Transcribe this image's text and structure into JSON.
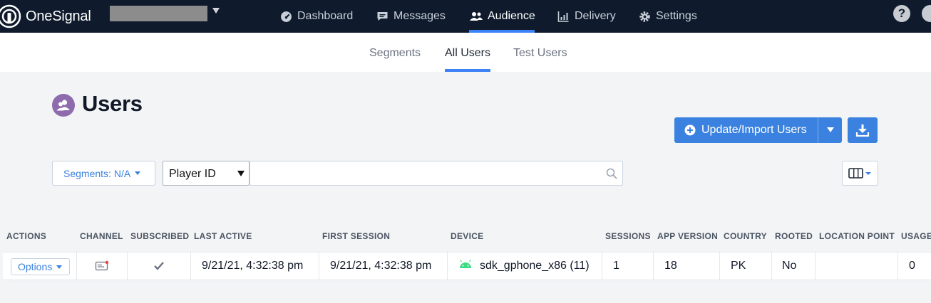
{
  "brand": {
    "name": "OneSignal",
    "accent": "#3b82e0",
    "nav_bg": "#0f1b2d"
  },
  "app_selector": {
    "value": ""
  },
  "nav": {
    "items": [
      {
        "label": "Dashboard",
        "icon": "dashboard-gauge-icon"
      },
      {
        "label": "Messages",
        "icon": "chat-bubble-icon"
      },
      {
        "label": "Audience",
        "icon": "users-icon",
        "active": true
      },
      {
        "label": "Delivery",
        "icon": "bar-chart-icon"
      },
      {
        "label": "Settings",
        "icon": "gear-icon"
      }
    ],
    "help_label": "?"
  },
  "subtabs": [
    {
      "label": "Segments"
    },
    {
      "label": "All Users",
      "active": true
    },
    {
      "label": "Test Users"
    }
  ],
  "page": {
    "title": "Users",
    "import_button": "Update/Import Users"
  },
  "filters": {
    "segments_label": "Segments:",
    "segments_value": "N/A",
    "field_select": "Player ID",
    "search_value": "",
    "search_placeholder": ""
  },
  "table": {
    "columns": [
      "ACTIONS",
      "CHANNEL",
      "SUBSCRIBED",
      "LAST ACTIVE",
      "FIRST SESSION",
      "DEVICE",
      "SESSIONS",
      "APP VERSION",
      "COUNTRY",
      "ROOTED",
      "LOCATION POINT",
      "USAGE"
    ],
    "rows": [
      {
        "actions": "Options",
        "channel_icon": "push-channel-icon",
        "subscribed_icon": "checkmark-icon",
        "last_active": "9/21/21, 4:32:38 pm",
        "first_session": "9/21/21, 4:32:38 pm",
        "device_icon": "android-icon",
        "device": "sdk_gphone_x86 (11)",
        "sessions": "1",
        "app_version": "18",
        "country": "PK",
        "rooted": "No",
        "location_point": "",
        "usage": "0"
      }
    ]
  }
}
